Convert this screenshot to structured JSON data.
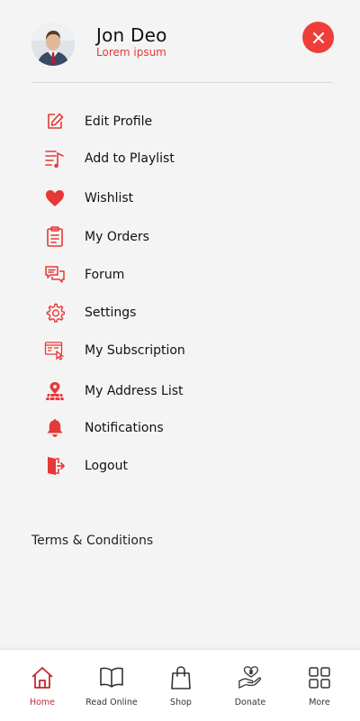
{
  "user": {
    "name": "Jon Deo",
    "subtitle": "Lorem ipsum"
  },
  "accent_color": "#ef3e3a",
  "menu": [
    {
      "label": "Edit Profile",
      "icon": "edit-icon"
    },
    {
      "label": "Add to Playlist",
      "icon": "playlist-add-icon"
    },
    {
      "label": "Wishlist",
      "icon": "heart-icon"
    },
    {
      "label": "My Orders",
      "icon": "clipboard-icon"
    },
    {
      "label": "Forum",
      "icon": "chat-bubbles-icon"
    },
    {
      "label": "Settings",
      "icon": "gear-icon"
    },
    {
      "label": "My Subscription",
      "icon": "subscription-icon"
    },
    {
      "label": "My Address List",
      "icon": "address-map-icon"
    },
    {
      "label": "Notifications",
      "icon": "bell-icon"
    },
    {
      "label": "Logout",
      "icon": "logout-icon"
    }
  ],
  "terms_label": "Terms & Conditions",
  "bottom_nav": [
    {
      "label": "Home",
      "icon": "home-icon",
      "active": true
    },
    {
      "label": "Read Online",
      "icon": "book-icon",
      "active": false
    },
    {
      "label": "Shop",
      "icon": "shopping-bag-icon",
      "active": false
    },
    {
      "label": "Donate",
      "icon": "donate-hand-icon",
      "active": false
    },
    {
      "label": "More",
      "icon": "grid-icon",
      "active": false
    }
  ]
}
